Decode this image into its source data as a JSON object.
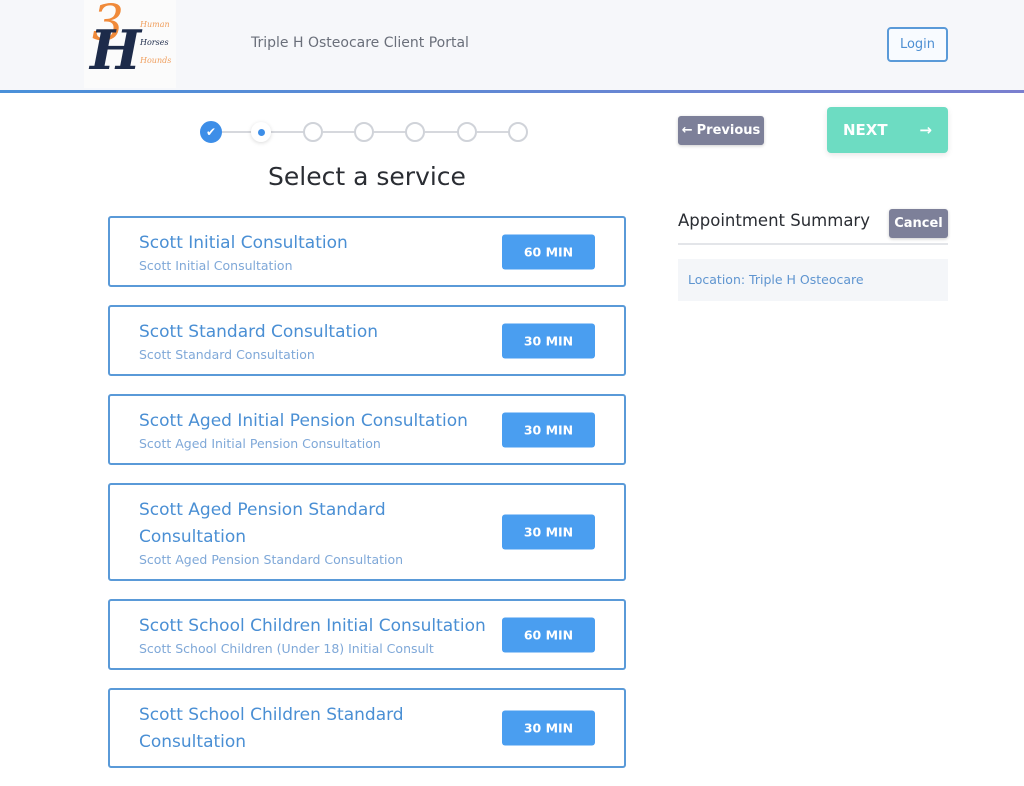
{
  "header": {
    "logo": {
      "numeral": "3",
      "letter": "H",
      "words": [
        "Human",
        "Horses",
        "Hounds"
      ]
    },
    "portal_title": "Triple H Osteocare Client Portal",
    "login_label": "Login"
  },
  "stepper": {
    "total_steps": 7,
    "completed_steps": 1,
    "current_step": 2,
    "check_icon": "✔"
  },
  "main": {
    "title": "Select a service",
    "services": [
      {
        "name": "Scott Initial Consultation",
        "description": "Scott Initial Consultation",
        "duration": "60 MIN"
      },
      {
        "name": "Scott Standard Consultation",
        "description": "Scott Standard Consultation",
        "duration": "30 MIN"
      },
      {
        "name": "Scott Aged Initial Pension Consultation",
        "description": "Scott Aged Initial Pension Consultation",
        "duration": "30 MIN"
      },
      {
        "name": "Scott Aged Pension Standard Consultation",
        "description": "Scott Aged Pension Standard Consultation",
        "duration": "30 MIN"
      },
      {
        "name": "Scott School Children Initial Consultation",
        "description": "Scott School Children (Under 18) Initial Consult",
        "duration": "60 MIN"
      },
      {
        "name": "Scott School Children Standard Consultation",
        "description": "",
        "duration": "30 MIN"
      }
    ]
  },
  "navigation": {
    "previous_label": "Previous",
    "previous_icon": "←",
    "next_label": "NEXT",
    "next_icon": "→"
  },
  "summary": {
    "title": "Appointment Summary",
    "cancel_label": "Cancel",
    "location": "Location: Triple H Osteocare"
  },
  "colors": {
    "accent_blue": "#4a9ef0",
    "next_green": "#6ddcc2",
    "secondary_gray": "#7d8099"
  }
}
